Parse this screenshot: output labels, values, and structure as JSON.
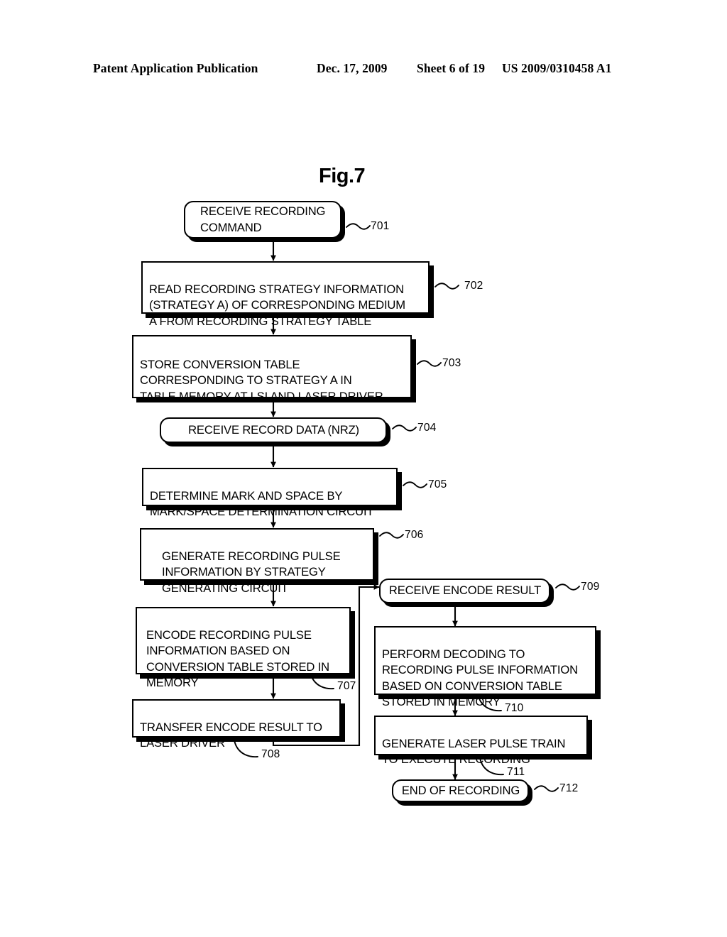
{
  "header": {
    "publication": "Patent Application Publication",
    "date": "Dec. 17, 2009",
    "sheet": "Sheet 6 of 19",
    "number": "US 2009/0310458 A1"
  },
  "figure": {
    "title": "Fig.7",
    "type": "flowchart",
    "colors": {
      "ink": "#000000",
      "paper": "#ffffff"
    },
    "boxes": [
      {
        "id": "701",
        "ref": "701",
        "shape": "rounded",
        "text": "RECEIVE RECORDING\nCOMMAND"
      },
      {
        "id": "702",
        "ref": "702",
        "shape": "rect",
        "text": "READ RECORDING STRATEGY INFORMATION\n(STRATEGY A) OF CORRESPONDING MEDIUM\nA FROM RECORDING STRATEGY TABLE"
      },
      {
        "id": "703",
        "ref": "703",
        "shape": "rect",
        "text": "STORE CONVERSION TABLE\nCORRESPONDING TO STRATEGY A IN\nTABLE MEMORY AT LSI AND LASER DRIVER"
      },
      {
        "id": "704",
        "ref": "704",
        "shape": "rounded",
        "text": "RECEIVE RECORD DATA (NRZ)"
      },
      {
        "id": "705",
        "ref": "705",
        "shape": "rect",
        "text": "DETERMINE MARK AND SPACE BY\nMARK/SPACE DETERMINATION CIRCUIT"
      },
      {
        "id": "706",
        "ref": "706",
        "shape": "rect",
        "text": "GENERATE RECORDING PULSE\nINFORMATION BY STRATEGY\nGENERATING CIRCUIT"
      },
      {
        "id": "707",
        "ref": "707",
        "shape": "rect",
        "text": "ENCODE RECORDING PULSE\nINFORMATION BASED ON\nCONVERSION TABLE STORED IN\nMEMORY"
      },
      {
        "id": "708",
        "ref": "708",
        "shape": "rect",
        "text": "TRANSFER ENCODE RESULT TO\nLASER DRIVER"
      },
      {
        "id": "709",
        "ref": "709",
        "shape": "rounded",
        "text": "RECEIVE ENCODE RESULT"
      },
      {
        "id": "710",
        "ref": "710",
        "shape": "rect",
        "text": "PERFORM DECODING TO\nRECORDING PULSE INFORMATION\nBASED ON CONVERSION TABLE\nSTORED IN MEMORY"
      },
      {
        "id": "711",
        "ref": "711",
        "shape": "rect",
        "text": "GENERATE LASER PULSE TRAIN\nTO EXECUTE RECORDING"
      },
      {
        "id": "712",
        "ref": "712",
        "shape": "rounded",
        "text": "END OF RECORDING"
      }
    ],
    "flow": [
      "701 -> 702",
      "702 -> 703",
      "703 -> 704",
      "704 -> 705",
      "705 -> 706",
      "706 -> 707",
      "707 -> 708",
      "708 -> 709",
      "709 -> 710",
      "710 -> 711",
      "711 -> 712"
    ]
  }
}
